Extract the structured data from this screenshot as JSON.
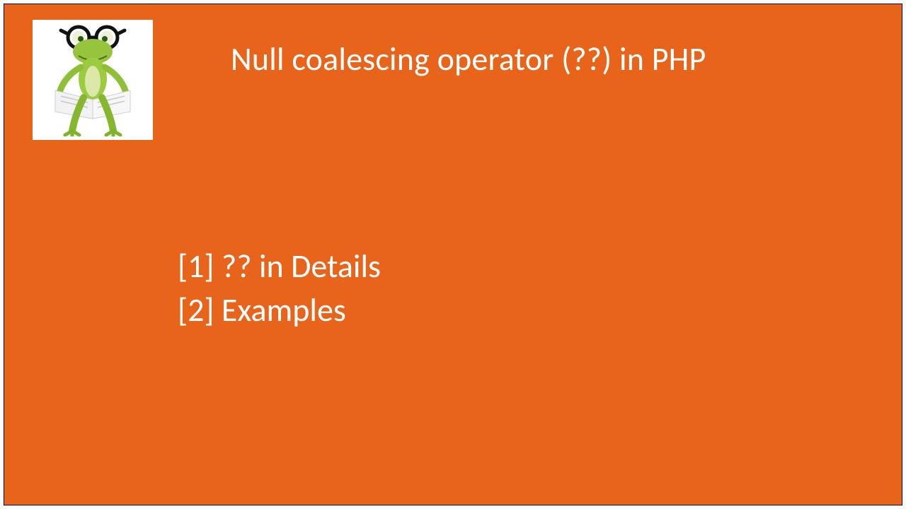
{
  "title": "Null coalescing operator (??) in PHP",
  "items": [
    "[1] ?? in Details",
    "[2] Examples"
  ],
  "logo_alt": "frog-reading-icon",
  "colors": {
    "background": "#e8641b",
    "text": "#ffffff"
  }
}
